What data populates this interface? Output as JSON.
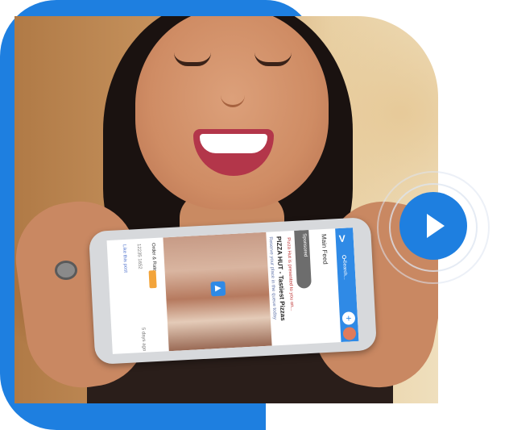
{
  "phone_screen": {
    "app_header": "Main Feed",
    "search_placeholder": "Search...",
    "sponsored_label": "Sponsored",
    "presenter_line": "Pizza Hut is presented to you on...",
    "post_title": "PIZZA HUT - Tastiest Pizzas",
    "post_subtitle": "Reserve your place in the queue today",
    "order_button": "Order & Rate",
    "post_stats": "12235  1652",
    "post_age": "5 days ago",
    "like_text": "Like this post"
  },
  "colors": {
    "accent": "#1e7fe0",
    "play_icon": "#ffffff"
  },
  "icons": {
    "play": "play-icon",
    "search": "search-icon",
    "add": "plus-icon"
  }
}
